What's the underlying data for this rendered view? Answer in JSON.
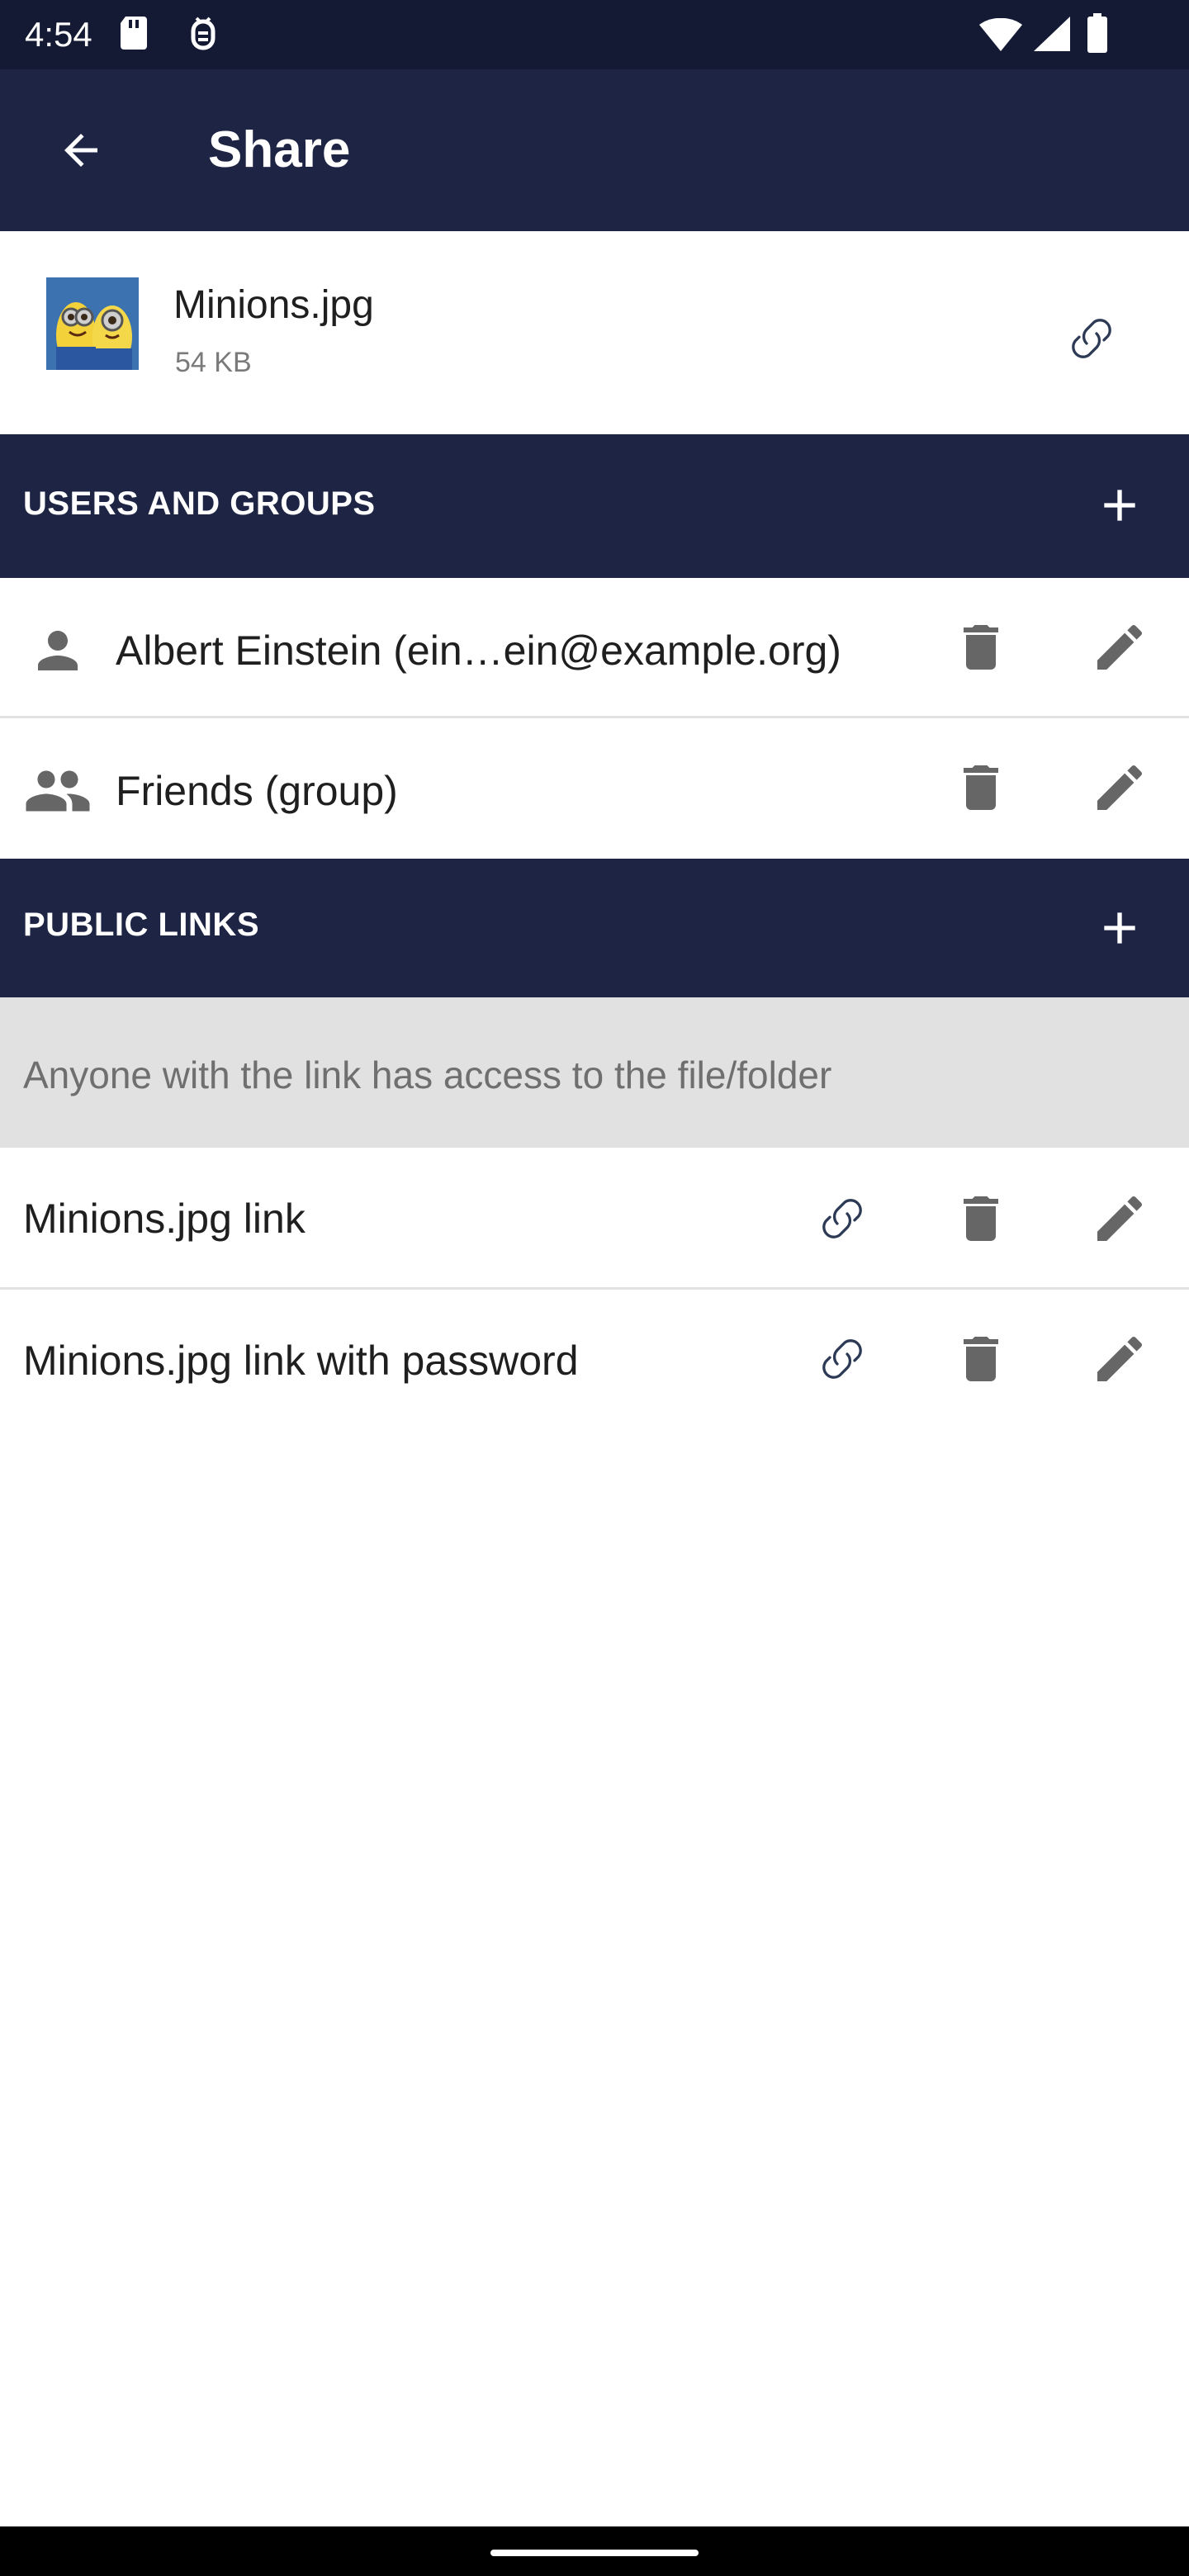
{
  "status_bar": {
    "time": "4:54",
    "icons": [
      "sd-card-icon",
      "debug-icon",
      "wifi-icon",
      "cellular-signal-icon",
      "battery-icon"
    ]
  },
  "app_bar": {
    "title": "Share",
    "back_icon": "arrow-back-icon"
  },
  "file": {
    "name": "Minions.jpg",
    "size": "54 KB",
    "link_icon": "link-icon"
  },
  "users_and_groups": {
    "title": "USERS AND GROUPS",
    "items": [
      {
        "label": "Albert Einstein (ein…ein@example.org)",
        "icon": "person-icon"
      },
      {
        "label": "Friends (group)",
        "icon": "group-icon"
      }
    ]
  },
  "public_links": {
    "title": "PUBLIC LINKS",
    "notice": "Anyone with the link has access to the file/folder",
    "items": [
      {
        "label": "Minions.jpg link"
      },
      {
        "label": "Minions.jpg link with password"
      }
    ]
  },
  "colors": {
    "header_bg": "#1e2444",
    "status_bg": "#141a33",
    "icon_gray": "#666666",
    "notice_bg": "#e1e1e1"
  }
}
